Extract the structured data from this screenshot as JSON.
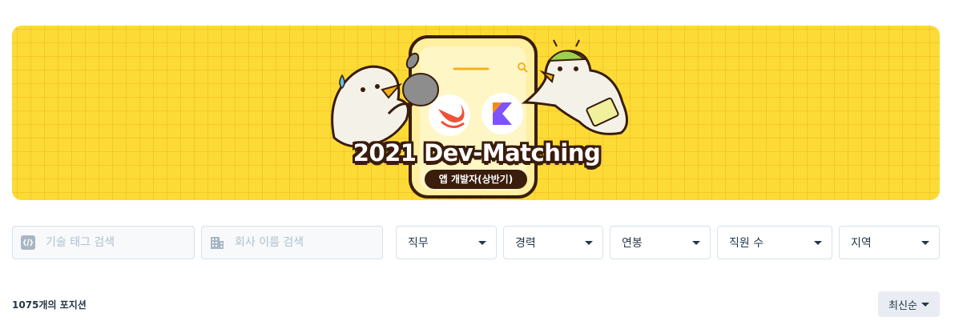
{
  "banner": {
    "title": "2021 Dev-Matching",
    "subtitle": "앱 개발자(상반기)",
    "colors": {
      "background": "#fddb37",
      "outline": "#3a1d0c"
    }
  },
  "filters": {
    "tech_search": {
      "placeholder": "기술 태그 검색",
      "icon": "code-icon"
    },
    "company_search": {
      "placeholder": "회사 이름 검색",
      "icon": "building-icon"
    },
    "dropdowns": [
      {
        "label": "직무"
      },
      {
        "label": "경력"
      },
      {
        "label": "연봉"
      },
      {
        "label": "직원 수"
      },
      {
        "label": "지역"
      }
    ]
  },
  "results": {
    "count_text": "1075개의 포지션",
    "sort_label": "최신순"
  }
}
